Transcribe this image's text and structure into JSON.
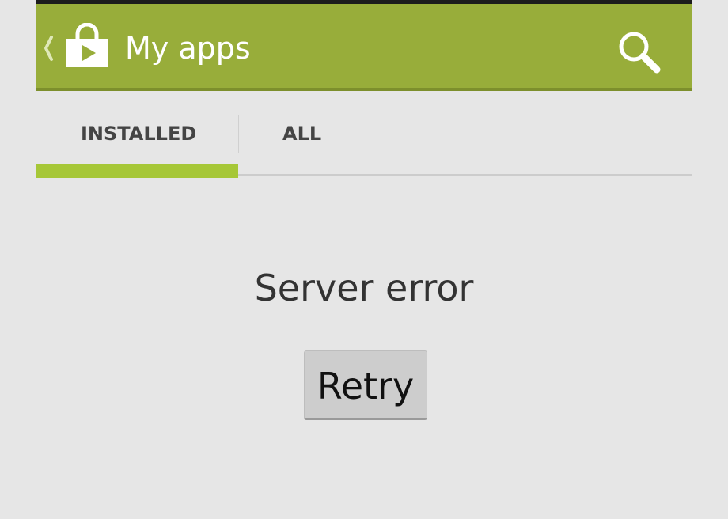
{
  "action_bar": {
    "title": "My apps",
    "color": "#98ad3a",
    "icons": [
      "up-caret-icon",
      "play-store-bag-icon",
      "search-icon"
    ]
  },
  "tabs": [
    {
      "label": "INSTALLED",
      "selected": true
    },
    {
      "label": "ALL",
      "selected": false
    }
  ],
  "accent_color": "#a6c737",
  "content": {
    "message": "Server error",
    "retry_label": "Retry"
  }
}
